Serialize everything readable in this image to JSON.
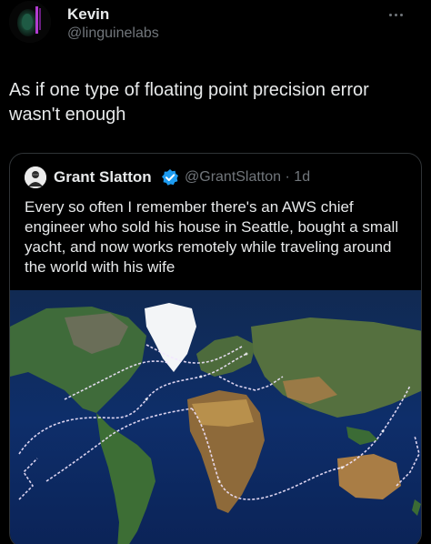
{
  "tweet": {
    "author_name": "Kevin",
    "author_handle": "@linguinelabs",
    "text": "As if one type of floating point precision error wasn't enough",
    "more_icon": "more-dots-icon"
  },
  "quoted": {
    "author_name": "Grant Slatton",
    "author_handle_time": "@GrantSlatton · 1d",
    "verified_icon": "verified-badge-icon",
    "text": "Every so often I remember there's an AWS chief engineer who sold his house in Seattle, bought a small yacht, and now works remotely while traveling around the world with his wife",
    "media": "world-map-route-image"
  },
  "colors": {
    "background": "#000000",
    "text": "#e7e9ea",
    "muted": "#71767b",
    "border": "#2f3336",
    "verified": "#1d9bf0",
    "route": "#f2e6ff"
  }
}
